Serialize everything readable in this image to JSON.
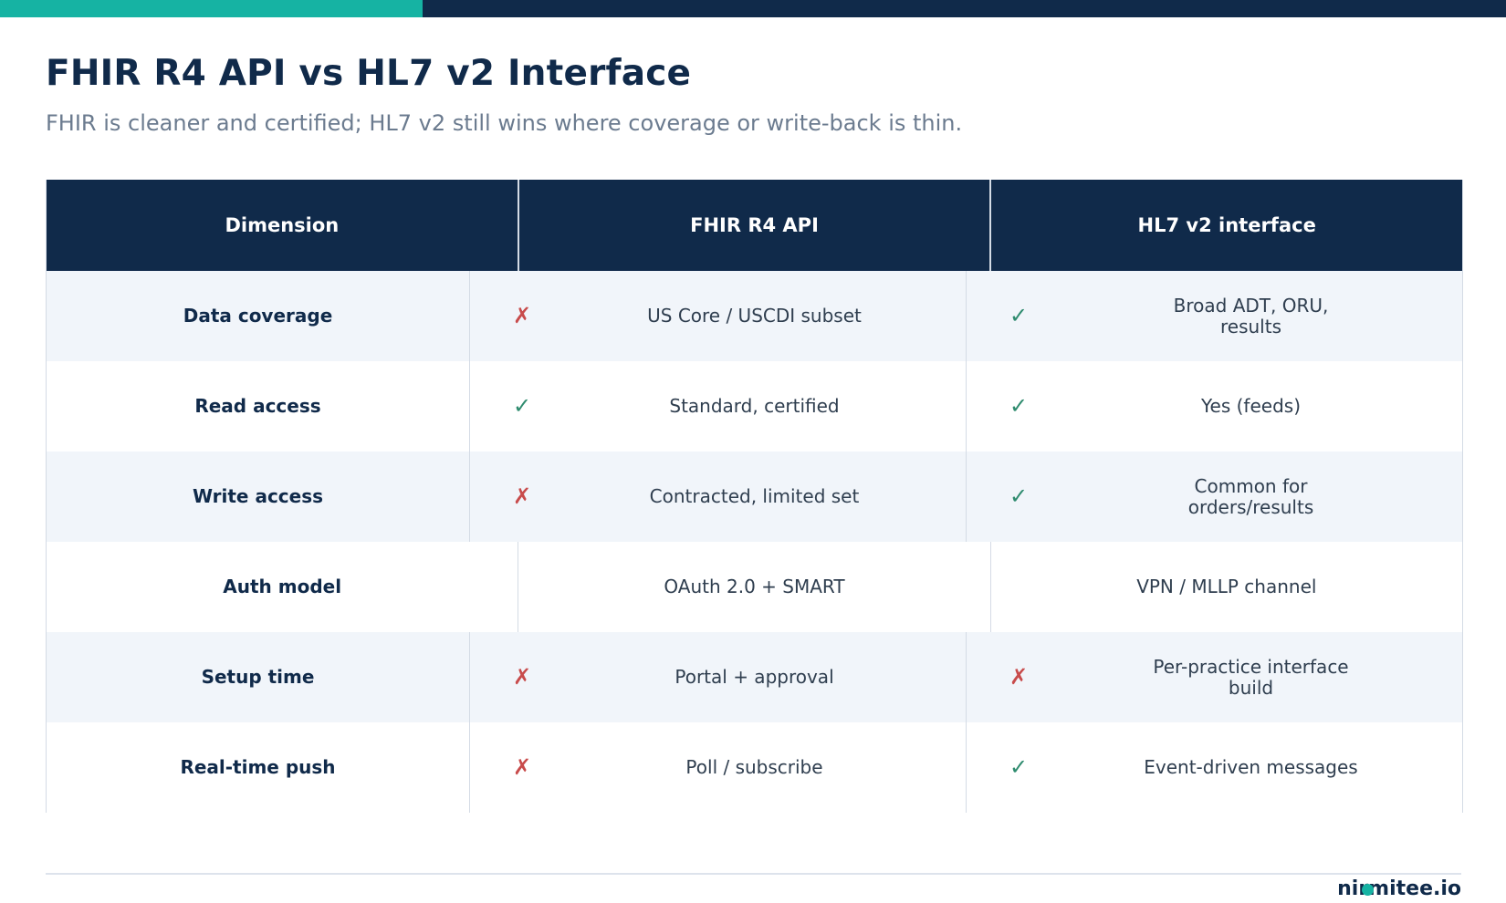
{
  "header": {
    "title": "FHIR R4 API vs HL7 v2 Interface",
    "subtitle": "FHIR is cleaner and certified; HL7 v2 still wins where coverage or write-back is thin."
  },
  "table": {
    "columns": [
      "Dimension",
      "FHIR R4 API",
      "HL7 v2 interface"
    ],
    "rows": [
      {
        "dimension": "Data coverage",
        "fhir": {
          "status": "cross",
          "icon": "✗",
          "text": "US Core / USCDI subset"
        },
        "hl7": {
          "status": "check",
          "icon": "✓",
          "text": "Broad ADT, ORU, results"
        }
      },
      {
        "dimension": "Read access",
        "fhir": {
          "status": "check",
          "icon": "✓",
          "text": "Standard, certified"
        },
        "hl7": {
          "status": "check",
          "icon": "✓",
          "text": "Yes (feeds)"
        }
      },
      {
        "dimension": "Write access",
        "fhir": {
          "status": "cross",
          "icon": "✗",
          "text": "Contracted, limited set"
        },
        "hl7": {
          "status": "check",
          "icon": "✓",
          "text": "Common for orders/results"
        }
      },
      {
        "dimension": "Auth model",
        "fhir": {
          "status": "none",
          "icon": "",
          "text": "OAuth 2.0 + SMART"
        },
        "hl7": {
          "status": "none",
          "icon": "",
          "text": "VPN / MLLP channel"
        }
      },
      {
        "dimension": "Setup time",
        "fhir": {
          "status": "cross",
          "icon": "✗",
          "text": "Portal + approval"
        },
        "hl7": {
          "status": "cross",
          "icon": "✗",
          "text": "Per-practice interface build"
        }
      },
      {
        "dimension": "Real-time push",
        "fhir": {
          "status": "cross",
          "icon": "✗",
          "text": "Poll / subscribe"
        },
        "hl7": {
          "status": "check",
          "icon": "✓",
          "text": "Event-driven messages"
        }
      }
    ]
  },
  "footer": {
    "brand": "nirmitee.io"
  },
  "colors": {
    "navy": "#102a4a",
    "teal": "#16b3a3",
    "check": "#2e8b6e",
    "cross": "#c84b4b",
    "alt_row": "#f1f5fa"
  }
}
